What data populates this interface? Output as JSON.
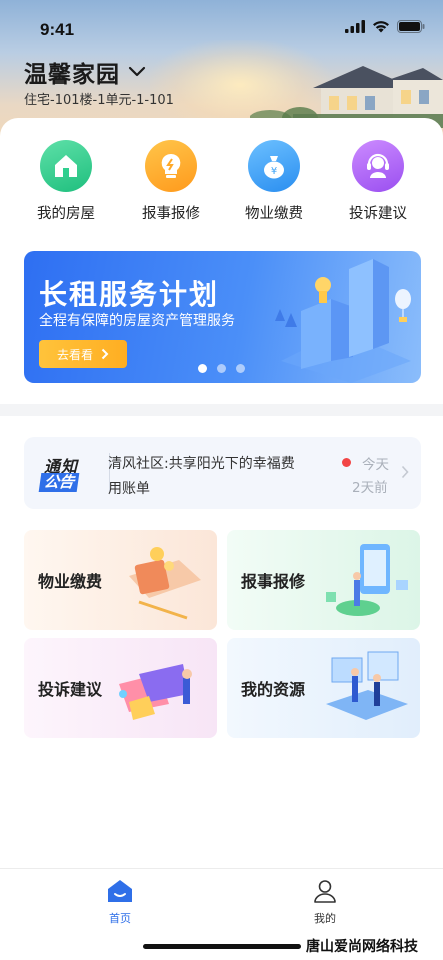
{
  "status_bar": {
    "time": "9:41"
  },
  "header": {
    "community_name": "温馨家园",
    "address": "住宅-101楼-1单元-1-101"
  },
  "quick_actions": [
    {
      "label": "我的房屋",
      "icon": "house-icon",
      "color": "#2fcf8f"
    },
    {
      "label": "报事报修",
      "icon": "lightbulb-icon",
      "color": "#ffa928"
    },
    {
      "label": "物业缴费",
      "icon": "money-bag-icon",
      "color": "#3ea3f5"
    },
    {
      "label": "投诉建议",
      "icon": "headset-icon",
      "color": "#b067f0"
    }
  ],
  "banner": {
    "title": "长租服务计划",
    "subtitle": "全程有保障的房屋资产管理服务",
    "button_label": "去看看",
    "slide_count": 3,
    "active_slide": 1
  },
  "notice": {
    "logo_line1": "通知",
    "logo_line2": "公告",
    "text": "清风社区:共享阳光下的幸福费用账单",
    "time_1": "今天",
    "time_2": "2天前"
  },
  "services": [
    {
      "label": "物业缴费"
    },
    {
      "label": "报事报修"
    },
    {
      "label": "投诉建议"
    },
    {
      "label": "我的资源"
    }
  ],
  "tabbar": {
    "home_label": "首页",
    "mine_label": "我的",
    "active_color": "#2f6fe8"
  },
  "watermark": "唐山爱尚网络科技"
}
